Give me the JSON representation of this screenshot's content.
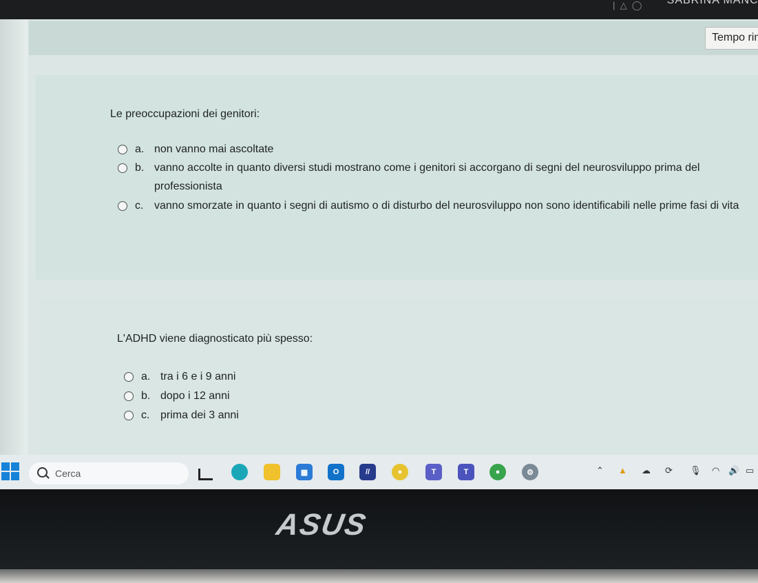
{
  "header": {
    "user_name": "SABRINA MANCI",
    "timer_label": "Tempo rimasto"
  },
  "questions": [
    {
      "prompt": "Le preoccupazioni dei genitori:",
      "options": [
        {
          "letter": "a.",
          "text": "non vanno mai ascoltate"
        },
        {
          "letter": "b.",
          "text": "vanno accolte in quanto diversi studi mostrano come i genitori si accorgano di segni del neurosviluppo prima del professionista"
        },
        {
          "letter": "c.",
          "text": "vanno smorzate in quanto i segni di autismo o di disturbo del neurosviluppo non sono identificabili nelle prime fasi di vita"
        }
      ]
    },
    {
      "prompt": "L'ADHD viene diagnosticato più spesso:",
      "options": [
        {
          "letter": "a.",
          "text": "tra i 6 e i 9 anni"
        },
        {
          "letter": "b.",
          "text": "dopo i 12 anni"
        },
        {
          "letter": "c.",
          "text": "prima dei 3 anni"
        }
      ]
    }
  ],
  "taskbar": {
    "search_placeholder": "Cerca",
    "apps": [
      "file-explorer-icon",
      "edge-icon",
      "folder-icon",
      "store-icon",
      "outlook-icon",
      "moodle-icon",
      "chrome-icon",
      "teams-icon",
      "teams-work-icon",
      "chrome-profile-icon",
      "settings-icon"
    ],
    "tray_icons": [
      "chevron-up-icon",
      "warning-icon",
      "cloud-icon",
      "onedrive-icon",
      "microphone-icon",
      "wifi-icon",
      "speaker-icon",
      "battery-icon"
    ]
  },
  "device": {
    "logo": "ASUS"
  }
}
